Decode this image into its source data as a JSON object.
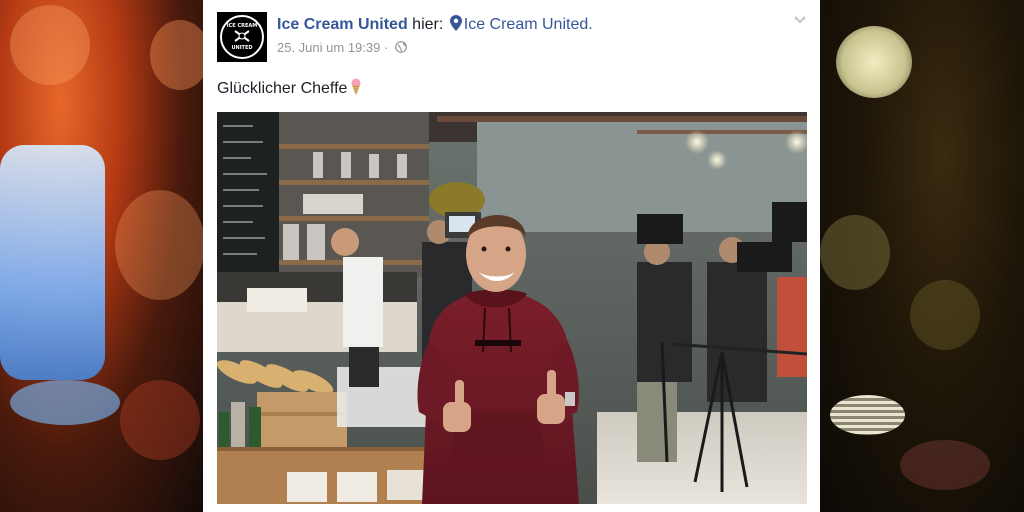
{
  "post": {
    "page_name": "Ice Cream United",
    "connector": "hier:",
    "location": "Ice Cream United.",
    "timestamp": "25. Juni um 19:39",
    "separator": "·",
    "text": "Glücklicher Cheffe"
  },
  "avatar": {
    "logo_text_top": "ICE CREAM",
    "logo_text_bottom": "UNITED"
  },
  "icons": {
    "location": "location-pin-icon",
    "privacy": "globe-icon",
    "menu": "chevron-down-icon",
    "emoji": "ice-cream-icon"
  },
  "colors": {
    "link": "#365899",
    "text": "#1d2129",
    "meta": "#90949c",
    "card_bg": "#ffffff"
  }
}
